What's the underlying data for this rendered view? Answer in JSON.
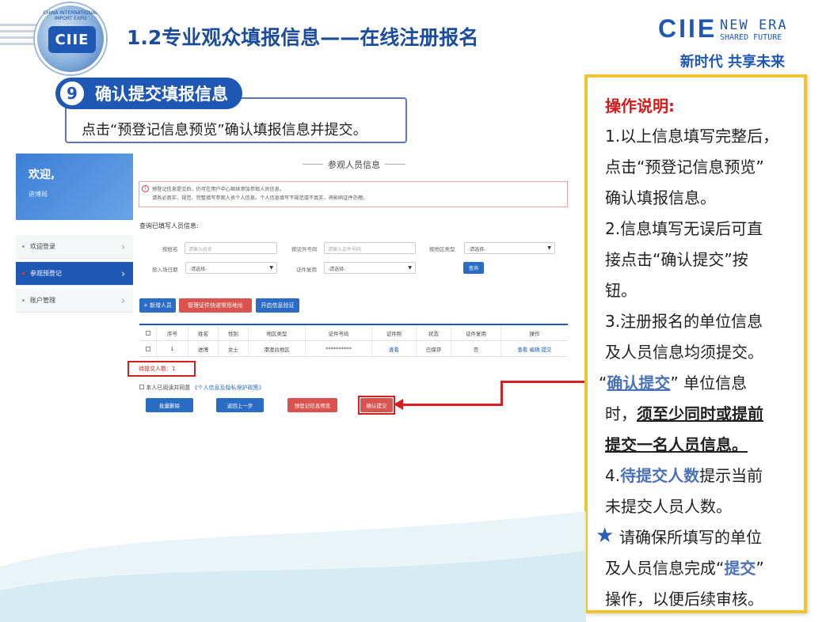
{
  "slide": {
    "title": "1.2专业观众填报信息——在线注册报名",
    "logo_text": "CIIE",
    "logo_ring": "CHINA INTERNATIONAL IMPORT EXPO",
    "brand_ciie": "CIIE",
    "brand_newera": "NEW ERA",
    "brand_shared": "SHARED FUTURE",
    "brand_cn": "新时代 共享未来"
  },
  "step": {
    "number": "9",
    "label": "确认提交填报信息",
    "description": "点击“预登记信息预览”确认填报信息并提交。"
  },
  "app": {
    "welcome": "欢迎,",
    "welcome_sub": "进博局",
    "sidebar": [
      {
        "label": "欢迎登录",
        "active": false
      },
      {
        "label": "参观预登记",
        "active": true
      },
      {
        "label": "账户管理",
        "active": false
      }
    ],
    "panel_title": "参观人员信息",
    "notice_line1": "预登记信息提交后，仍可在用户中心继续添加参观人员信息。",
    "notice_line2": "请务必真实、规范、完整填写参观人员个人信息。个人信息填写不规范或不真实，将影响证件办理。",
    "query_title": "查询已填写人员信息:",
    "filters": {
      "name_label": "按姓名",
      "name_placeholder": "请输入姓名",
      "cert_label": "按证件号码",
      "cert_placeholder": "请输入证件号码",
      "region_label": "按地区类型",
      "region_value": "-请选择-",
      "date_label": "按入场日期",
      "date_value": "-请选择-",
      "reuse_label": "证件复用",
      "reuse_value": "-请选择-",
      "query_button": "查询"
    },
    "toolbar": {
      "add": "+ 新增人员",
      "manage": "管理证件快递常用地址",
      "verify": "开启信息验证"
    },
    "table": {
      "headers": [
        "序号",
        "姓名",
        "性别",
        "地区类型",
        "证件号码",
        "证件照",
        "状态",
        "证件复用",
        "操作"
      ],
      "rows": [
        {
          "no": "1",
          "name": "进博",
          "gender": "女士",
          "region": "港澳台地区",
          "cert": "**********",
          "photo": "查看",
          "status": "已保存",
          "reuse": "否",
          "ops": "查看 编辑 提交"
        }
      ]
    },
    "pending": "待提交人数：1",
    "agree_prefix": "本人已阅读并同意",
    "agree_link": "《个人信息及隐私保护政策》",
    "actions": {
      "batch_delete": "批量删除",
      "back": "返回上一步",
      "preview": "预登记信息预览",
      "confirm": "确认提交"
    }
  },
  "instructions": {
    "title": "操作说明:",
    "l1": "1.以上信息填写完整后，",
    "l2": "点击“预登记信息预览”",
    "l3": "确认填报信息。",
    "l4": "2.信息填写无误后可直",
    "l5": "接点击“确认提交”按",
    "l6": "钮。",
    "l7": "3.注册报名的单位信息",
    "l8": "及人员信息均须提交。",
    "l9_q1": "“",
    "l9_hl": "确认提交",
    "l9_q2": "”",
    "l9_rest": "单位信息",
    "l10_a": "时，",
    "l10_b": "须至少同时或提前",
    "l11": "提交一名人员信息。",
    "l12_hl": "4.待提交人数",
    "l12_rest": "提示当前",
    "l12_prefix": "4.",
    "l12_hl2": "待提交人数",
    "l13": "未提交人员人数。",
    "l14": "请确保所填写的单位",
    "l15_a": "及人员信息完成“",
    "l15_hl": "提交",
    "l15_b": "”",
    "l16": "操作，以便后续审核。"
  },
  "colors": {
    "brand_blue": "#1f57b5",
    "highlight_red": "#d42020",
    "panel_border": "#f0c330"
  }
}
